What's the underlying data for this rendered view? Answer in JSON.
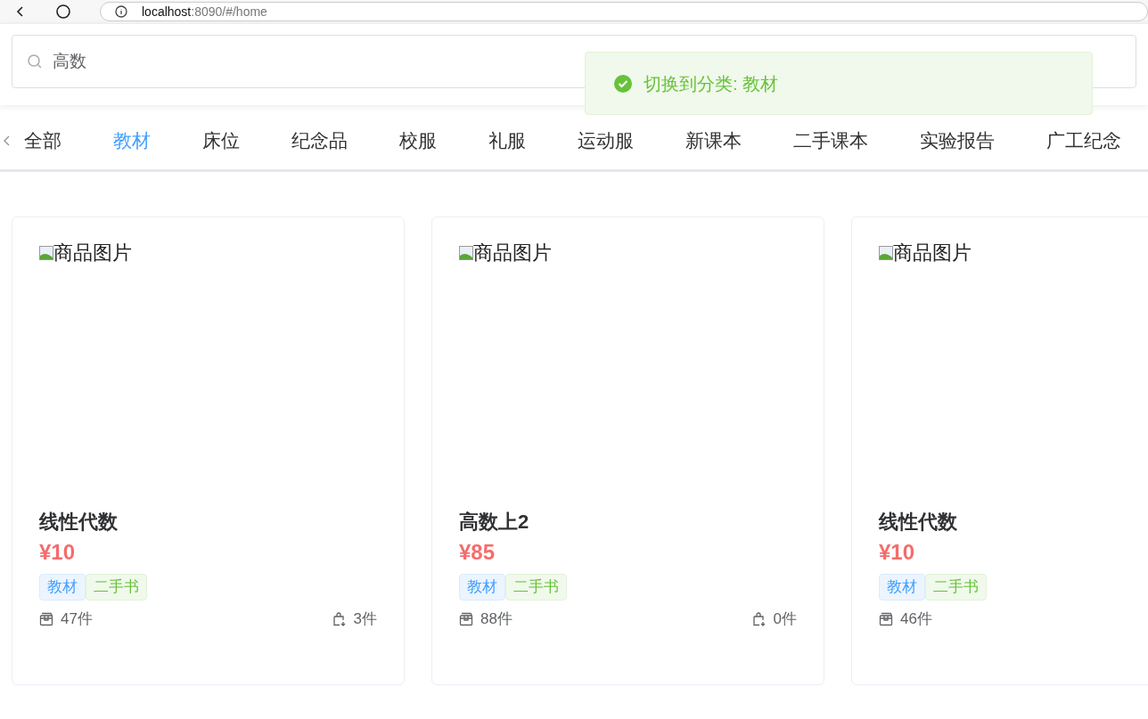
{
  "browser": {
    "url_host": "localhost",
    "url_path": ":8090/#/home"
  },
  "search": {
    "value": "高数"
  },
  "toast": {
    "kind": "success",
    "message": "切换到分类: 教材"
  },
  "tabs": [
    {
      "label": "全部",
      "selected": false
    },
    {
      "label": "教材",
      "selected": true
    },
    {
      "label": "床位",
      "selected": false
    },
    {
      "label": "纪念品",
      "selected": false
    },
    {
      "label": "校服",
      "selected": false
    },
    {
      "label": "礼服",
      "selected": false
    },
    {
      "label": "运动服",
      "selected": false
    },
    {
      "label": "新课本",
      "selected": false
    },
    {
      "label": "二手课本",
      "selected": false
    },
    {
      "label": "实验报告",
      "selected": false
    },
    {
      "label": "广工纪念",
      "selected": false
    }
  ],
  "products": [
    {
      "image_alt": "商品图片",
      "title": "线性代数",
      "price": "¥10",
      "tags": [
        {
          "label": "教材",
          "kind": "category"
        },
        {
          "label": "二手书",
          "kind": "condition"
        }
      ],
      "stock": "47件",
      "sold": "3件"
    },
    {
      "image_alt": "商品图片",
      "title": "高数上2",
      "price": "¥85",
      "tags": [
        {
          "label": "教材",
          "kind": "category"
        },
        {
          "label": "二手书",
          "kind": "condition"
        }
      ],
      "stock": "88件",
      "sold": "0件"
    },
    {
      "image_alt": "商品图片",
      "title": "线性代数",
      "price": "¥10",
      "tags": [
        {
          "label": "教材",
          "kind": "category"
        },
        {
          "label": "二手书",
          "kind": "condition"
        }
      ],
      "stock": "46件"
    }
  ]
}
